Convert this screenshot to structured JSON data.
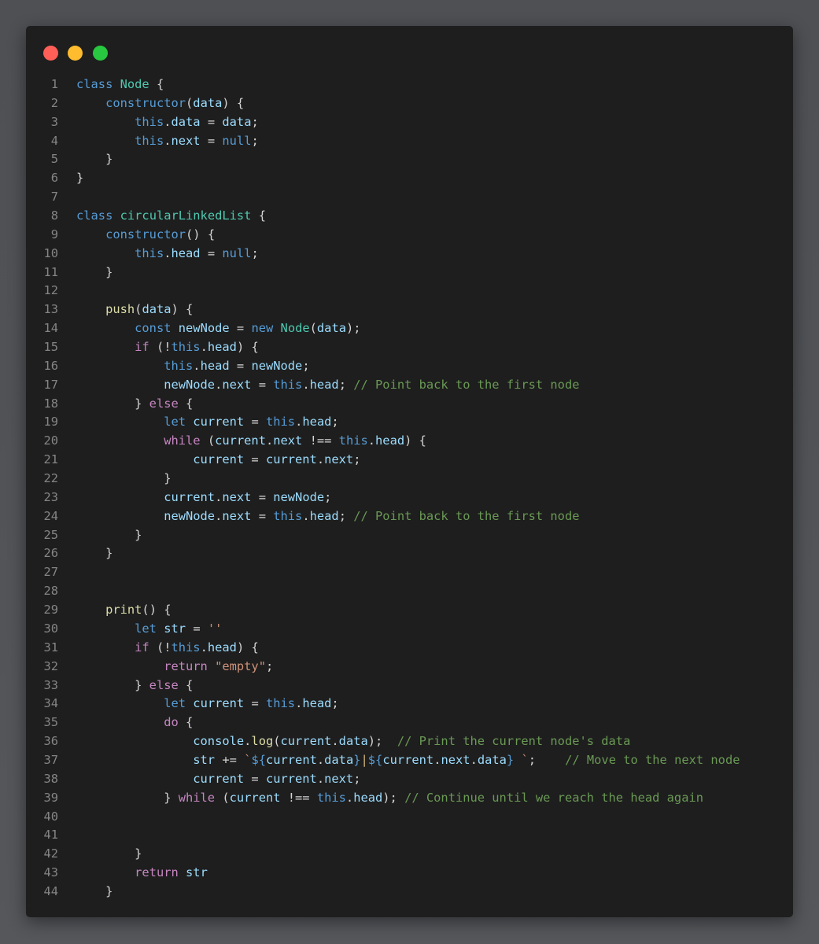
{
  "window": {
    "controls": [
      "close",
      "minimize",
      "maximize"
    ]
  },
  "colors": {
    "keyword": "#569cd6",
    "control": "#c586c0",
    "class": "#4ec9b0",
    "function": "#dcdcaa",
    "variable": "#9cdcfe",
    "string": "#ce9178",
    "comment": "#6a9955",
    "plain": "#d4d4d4",
    "line_number": "#858585",
    "editor_bg": "#1e1e1e"
  },
  "code": {
    "lines": [
      [
        [
          "kw",
          "class"
        ],
        [
          "p",
          " "
        ],
        [
          "cls",
          "Node"
        ],
        [
          "p",
          " {"
        ]
      ],
      [
        [
          "p",
          "    "
        ],
        [
          "kw",
          "constructor"
        ],
        [
          "p",
          "("
        ],
        [
          "var",
          "data"
        ],
        [
          "p",
          ") {"
        ]
      ],
      [
        [
          "p",
          "        "
        ],
        [
          "kw",
          "this"
        ],
        [
          "p",
          "."
        ],
        [
          "var",
          "data"
        ],
        [
          "p",
          " = "
        ],
        [
          "var",
          "data"
        ],
        [
          "p",
          ";"
        ]
      ],
      [
        [
          "p",
          "        "
        ],
        [
          "kw",
          "this"
        ],
        [
          "p",
          "."
        ],
        [
          "var",
          "next"
        ],
        [
          "p",
          " = "
        ],
        [
          "kw",
          "null"
        ],
        [
          "p",
          ";"
        ]
      ],
      [
        [
          "p",
          "    }"
        ]
      ],
      [
        [
          "p",
          "}"
        ]
      ],
      [],
      [
        [
          "kw",
          "class"
        ],
        [
          "p",
          " "
        ],
        [
          "cls",
          "circularLinkedList"
        ],
        [
          "p",
          " {"
        ]
      ],
      [
        [
          "p",
          "    "
        ],
        [
          "kw",
          "constructor"
        ],
        [
          "p",
          "() {"
        ]
      ],
      [
        [
          "p",
          "        "
        ],
        [
          "kw",
          "this"
        ],
        [
          "p",
          "."
        ],
        [
          "var",
          "head"
        ],
        [
          "p",
          " = "
        ],
        [
          "kw",
          "null"
        ],
        [
          "p",
          ";"
        ]
      ],
      [
        [
          "p",
          "    }"
        ]
      ],
      [],
      [
        [
          "p",
          "    "
        ],
        [
          "fn",
          "push"
        ],
        [
          "p",
          "("
        ],
        [
          "var",
          "data"
        ],
        [
          "p",
          ") {"
        ]
      ],
      [
        [
          "p",
          "        "
        ],
        [
          "kw",
          "const"
        ],
        [
          "p",
          " "
        ],
        [
          "var",
          "newNode"
        ],
        [
          "p",
          " = "
        ],
        [
          "kw",
          "new"
        ],
        [
          "p",
          " "
        ],
        [
          "cls",
          "Node"
        ],
        [
          "p",
          "("
        ],
        [
          "var",
          "data"
        ],
        [
          "p",
          ");"
        ]
      ],
      [
        [
          "p",
          "        "
        ],
        [
          "ctl",
          "if"
        ],
        [
          "p",
          " (!"
        ],
        [
          "kw",
          "this"
        ],
        [
          "p",
          "."
        ],
        [
          "var",
          "head"
        ],
        [
          "p",
          ") {"
        ]
      ],
      [
        [
          "p",
          "            "
        ],
        [
          "kw",
          "this"
        ],
        [
          "p",
          "."
        ],
        [
          "var",
          "head"
        ],
        [
          "p",
          " = "
        ],
        [
          "var",
          "newNode"
        ],
        [
          "p",
          ";"
        ]
      ],
      [
        [
          "p",
          "            "
        ],
        [
          "var",
          "newNode"
        ],
        [
          "p",
          "."
        ],
        [
          "var",
          "next"
        ],
        [
          "p",
          " = "
        ],
        [
          "kw",
          "this"
        ],
        [
          "p",
          "."
        ],
        [
          "var",
          "head"
        ],
        [
          "p",
          "; "
        ],
        [
          "cmt",
          "// Point back to the first node"
        ]
      ],
      [
        [
          "p",
          "        } "
        ],
        [
          "ctl",
          "else"
        ],
        [
          "p",
          " {"
        ]
      ],
      [
        [
          "p",
          "            "
        ],
        [
          "kw",
          "let"
        ],
        [
          "p",
          " "
        ],
        [
          "var",
          "current"
        ],
        [
          "p",
          " = "
        ],
        [
          "kw",
          "this"
        ],
        [
          "p",
          "."
        ],
        [
          "var",
          "head"
        ],
        [
          "p",
          ";"
        ]
      ],
      [
        [
          "p",
          "            "
        ],
        [
          "ctl",
          "while"
        ],
        [
          "p",
          " ("
        ],
        [
          "var",
          "current"
        ],
        [
          "p",
          "."
        ],
        [
          "var",
          "next"
        ],
        [
          "p",
          " !== "
        ],
        [
          "kw",
          "this"
        ],
        [
          "p",
          "."
        ],
        [
          "var",
          "head"
        ],
        [
          "p",
          ") {"
        ]
      ],
      [
        [
          "p",
          "                "
        ],
        [
          "var",
          "current"
        ],
        [
          "p",
          " = "
        ],
        [
          "var",
          "current"
        ],
        [
          "p",
          "."
        ],
        [
          "var",
          "next"
        ],
        [
          "p",
          ";"
        ]
      ],
      [
        [
          "p",
          "            }"
        ]
      ],
      [
        [
          "p",
          "            "
        ],
        [
          "var",
          "current"
        ],
        [
          "p",
          "."
        ],
        [
          "var",
          "next"
        ],
        [
          "p",
          " = "
        ],
        [
          "var",
          "newNode"
        ],
        [
          "p",
          ";"
        ]
      ],
      [
        [
          "p",
          "            "
        ],
        [
          "var",
          "newNode"
        ],
        [
          "p",
          "."
        ],
        [
          "var",
          "next"
        ],
        [
          "p",
          " = "
        ],
        [
          "kw",
          "this"
        ],
        [
          "p",
          "."
        ],
        [
          "var",
          "head"
        ],
        [
          "p",
          "; "
        ],
        [
          "cmt",
          "// Point back to the first node"
        ]
      ],
      [
        [
          "p",
          "        }"
        ]
      ],
      [
        [
          "p",
          "    }"
        ]
      ],
      [],
      [],
      [
        [
          "p",
          "    "
        ],
        [
          "fn",
          "print"
        ],
        [
          "p",
          "() {"
        ]
      ],
      [
        [
          "p",
          "        "
        ],
        [
          "kw",
          "let"
        ],
        [
          "p",
          " "
        ],
        [
          "var",
          "str"
        ],
        [
          "p",
          " = "
        ],
        [
          "str",
          "''"
        ]
      ],
      [
        [
          "p",
          "        "
        ],
        [
          "ctl",
          "if"
        ],
        [
          "p",
          " (!"
        ],
        [
          "kw",
          "this"
        ],
        [
          "p",
          "."
        ],
        [
          "var",
          "head"
        ],
        [
          "p",
          ") {"
        ]
      ],
      [
        [
          "p",
          "            "
        ],
        [
          "ctl",
          "return"
        ],
        [
          "p",
          " "
        ],
        [
          "str",
          "\"empty\""
        ],
        [
          "p",
          ";"
        ]
      ],
      [
        [
          "p",
          "        } "
        ],
        [
          "ctl",
          "else"
        ],
        [
          "p",
          " {"
        ]
      ],
      [
        [
          "p",
          "            "
        ],
        [
          "kw",
          "let"
        ],
        [
          "p",
          " "
        ],
        [
          "var",
          "current"
        ],
        [
          "p",
          " = "
        ],
        [
          "kw",
          "this"
        ],
        [
          "p",
          "."
        ],
        [
          "var",
          "head"
        ],
        [
          "p",
          ";"
        ]
      ],
      [
        [
          "p",
          "            "
        ],
        [
          "ctl",
          "do"
        ],
        [
          "p",
          " {"
        ]
      ],
      [
        [
          "p",
          "                "
        ],
        [
          "var",
          "console"
        ],
        [
          "p",
          "."
        ],
        [
          "fn",
          "log"
        ],
        [
          "p",
          "("
        ],
        [
          "var",
          "current"
        ],
        [
          "p",
          "."
        ],
        [
          "var",
          "data"
        ],
        [
          "p",
          ");  "
        ],
        [
          "cmt",
          "// Print the current node's data"
        ]
      ],
      [
        [
          "p",
          "                "
        ],
        [
          "var",
          "str"
        ],
        [
          "p",
          " += "
        ],
        [
          "str",
          "`"
        ],
        [
          "kw",
          "${"
        ],
        [
          "var",
          "current"
        ],
        [
          "p",
          "."
        ],
        [
          "var",
          "data"
        ],
        [
          "kw",
          "}"
        ],
        [
          "cursor",
          "|"
        ],
        [
          "kw",
          "${"
        ],
        [
          "var",
          "current"
        ],
        [
          "p",
          "."
        ],
        [
          "var",
          "next"
        ],
        [
          "p",
          "."
        ],
        [
          "var",
          "data"
        ],
        [
          "kw",
          "}"
        ],
        [
          "str",
          " `"
        ],
        [
          "p",
          ";    "
        ],
        [
          "cmt",
          "// Move to the next node"
        ]
      ],
      [
        [
          "p",
          "                "
        ],
        [
          "var",
          "current"
        ],
        [
          "p",
          " = "
        ],
        [
          "var",
          "current"
        ],
        [
          "p",
          "."
        ],
        [
          "var",
          "next"
        ],
        [
          "p",
          ";"
        ]
      ],
      [
        [
          "p",
          "            } "
        ],
        [
          "ctl",
          "while"
        ],
        [
          "p",
          " ("
        ],
        [
          "var",
          "current"
        ],
        [
          "p",
          " !== "
        ],
        [
          "kw",
          "this"
        ],
        [
          "p",
          "."
        ],
        [
          "var",
          "head"
        ],
        [
          "p",
          "); "
        ],
        [
          "cmt",
          "// Continue until we reach the head again"
        ]
      ],
      [],
      [],
      [
        [
          "p",
          "        }"
        ]
      ],
      [
        [
          "p",
          "        "
        ],
        [
          "ctl",
          "return"
        ],
        [
          "p",
          " "
        ],
        [
          "var",
          "str"
        ]
      ],
      [
        [
          "p",
          "    }"
        ]
      ]
    ]
  }
}
